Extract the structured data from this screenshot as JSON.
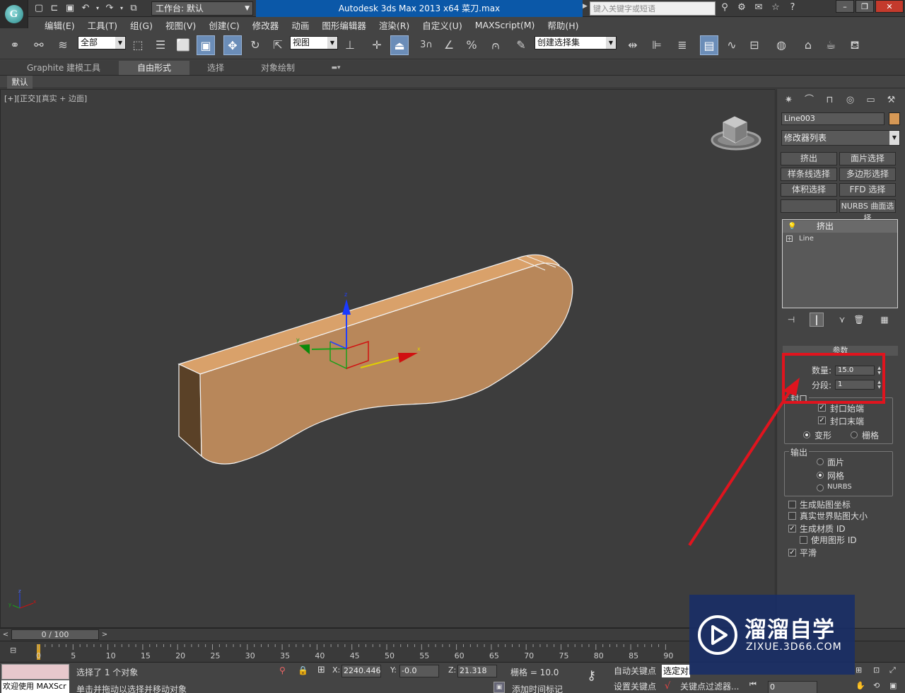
{
  "title_bar": {
    "workspace_label": "工作台: 默认",
    "app_title": "Autodesk 3ds Max  2013 x64       菜刀.max",
    "search_placeholder": "键入关键字或短语"
  },
  "menu": [
    "编辑(E)",
    "工具(T)",
    "组(G)",
    "视图(V)",
    "创建(C)",
    "修改器",
    "动画",
    "图形编辑器",
    "渲染(R)",
    "自定义(U)",
    "MAXScript(M)",
    "帮助(H)"
  ],
  "toolbar": {
    "selection_filter": "全部",
    "ref_coord": "视图",
    "named_selection": "创建选择集",
    "snap_label": "3"
  },
  "ribbon": {
    "tabs": [
      "Graphite 建模工具",
      "自由形式",
      "选择",
      "对象绘制"
    ],
    "active_tab": "自由形式",
    "sub_tab": "默认"
  },
  "viewport": {
    "label_prefix": "[+][",
    "label_view": "正交",
    "label_sep": "][",
    "label_shading": "真实 + 边面",
    "label_suffix": "]",
    "gizmo_axes": {
      "x": "x",
      "y": "y",
      "z": "z"
    },
    "object_color": "#b8875a"
  },
  "command_panel": {
    "object_name": "Line003",
    "object_color": "#d69855",
    "modifier_list": "修改器列表",
    "modifier_buttons": [
      "挤出",
      "面片选择",
      "样条线选择",
      "多边形选择",
      "体积选择",
      "FFD 选择",
      "",
      "NURBS 曲面选择"
    ],
    "stack": [
      "挤出",
      "Line"
    ],
    "rollout_title": "参数",
    "amount_label": "数量:",
    "amount_value": "15.0",
    "segments_label": "分段:",
    "segments_value": "1",
    "cap_group": "封口",
    "cap_start": "封口始端",
    "cap_end": "封口末端",
    "morph": "变形",
    "grid": "栅格",
    "output_group": "输出",
    "output_patch": "面片",
    "output_mesh": "网格",
    "output_nurbs": "NURBS",
    "gen_mapping": "生成贴图坐标",
    "real_world": "真实世界贴图大小",
    "gen_mat_id": "生成材质 ID",
    "use_shape_id": "使用图形 ID",
    "smooth": "平滑",
    "checks": {
      "cap_start": true,
      "cap_end": true,
      "gen_mapping": false,
      "real_world": false,
      "gen_mat_id": true,
      "use_shape_id": false,
      "smooth": true
    },
    "cap_type": "变形",
    "output_type": "网格"
  },
  "timeline": {
    "frame_display": "0 / 100",
    "ticks": [
      "0",
      "5",
      "10",
      "15",
      "20",
      "25",
      "30",
      "35",
      "40",
      "45",
      "50",
      "55",
      "60",
      "65",
      "70",
      "75",
      "80",
      "85",
      "90"
    ]
  },
  "status": {
    "maxscript_label": "欢迎使用 MAXScr",
    "selected_text": "选择了 1 个对象",
    "hint_text": "单击并拖动以选择并移动对象",
    "x_label": "X:",
    "x_value": "2240.446",
    "y_label": "Y:",
    "y_value": "-0.0",
    "z_label": "Z:",
    "z_value": "21.318",
    "grid_text": "栅格 = 10.0",
    "auto_key": "自动关键点",
    "set_key": "设置关键点",
    "selected_combo": "选定对",
    "add_time_tag": "添加时间标记",
    "key_filter": "关键点过滤器...",
    "frame_value": "0"
  },
  "watermark": {
    "title": "溜溜自学",
    "url": "ZIXUE.3D66.COM"
  },
  "annotation": {
    "color": "#e0141e"
  }
}
